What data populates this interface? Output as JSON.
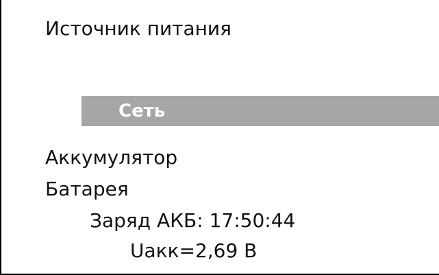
{
  "screen": {
    "title": "Источник питания",
    "menu_items": [
      {
        "label": "Сеть",
        "selected": true
      },
      {
        "label": "Аккумулятор",
        "selected": false
      },
      {
        "label": "Батарея",
        "selected": false
      }
    ],
    "status": {
      "charge_label": "Заряд АКБ: 17:50:44",
      "voltage_label": "Uакк=2,69 В"
    }
  },
  "colors": {
    "background": "#ffffff",
    "text": "#111111",
    "selection_background": "#a6a6a6",
    "selection_text": "#ffffff",
    "border": "#000000"
  }
}
